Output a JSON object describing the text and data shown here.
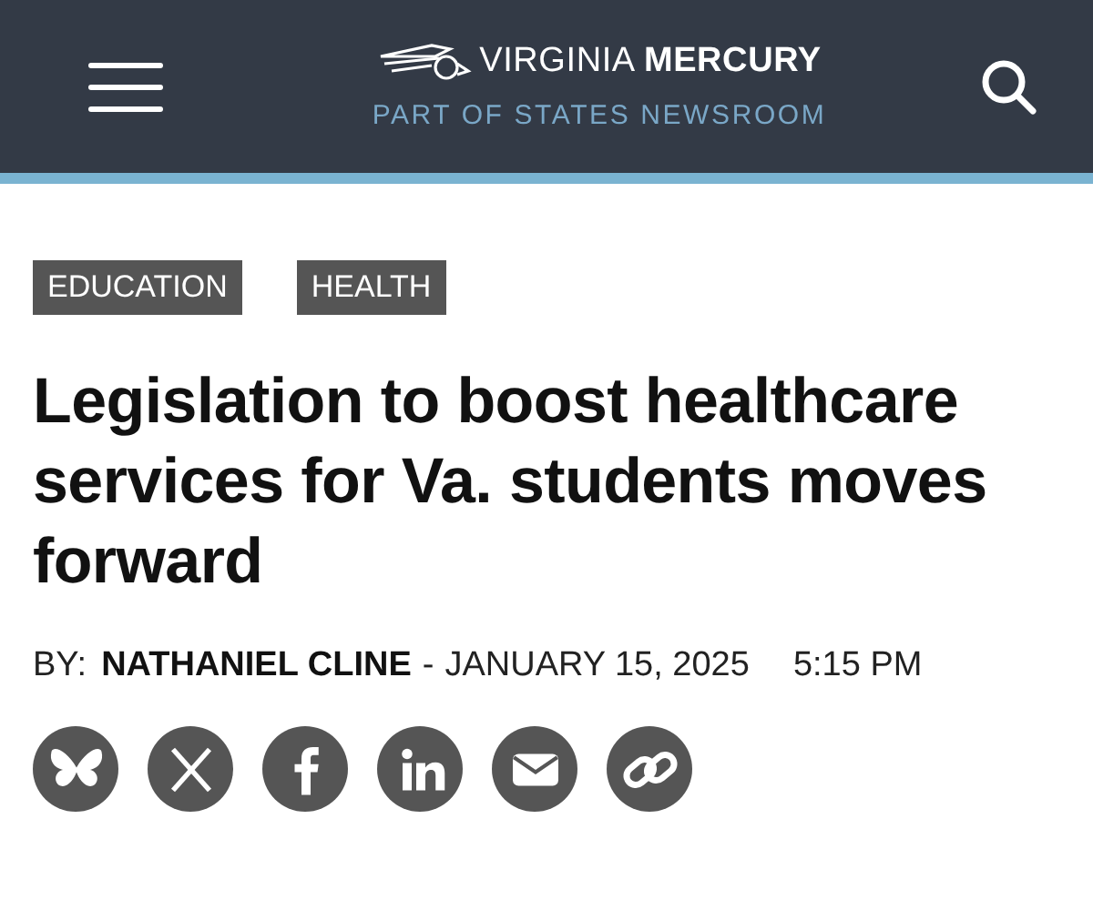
{
  "header": {
    "logo": "VIRGINIA **MERCURY**",
    "tagline": "PART OF STATES NEWSROOM"
  },
  "tags": [
    "EDUCATION",
    "HEALTH"
  ],
  "headline": "Legislation to boost healthcare services for Va. students moves forward",
  "byline": {
    "prefix": "BY:",
    "author": "NATHANIEL CLINE",
    "separator": "-",
    "date": "JANUARY 15, 2025",
    "time": "5:15 PM"
  },
  "share": [
    {
      "kind": "butterfly"
    },
    {
      "kind": "x"
    },
    {
      "kind": "f"
    },
    {
      "kind": "in"
    },
    {
      "kind": "mail"
    },
    {
      "kind": "link"
    }
  ]
}
